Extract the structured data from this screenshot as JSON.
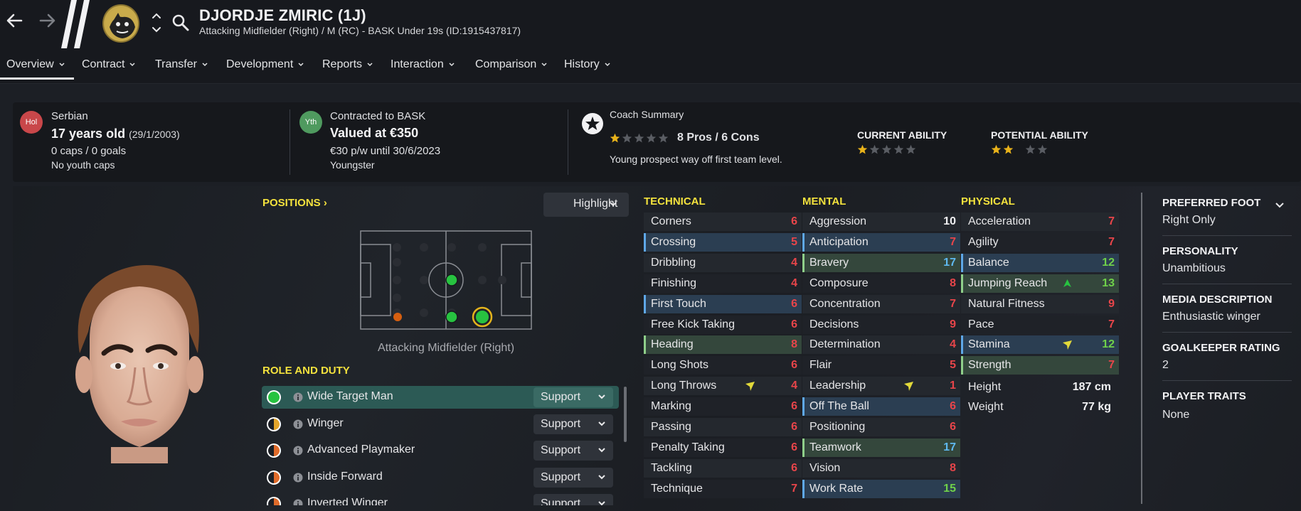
{
  "colors": {
    "accent_yellow": "#f4e23d",
    "value_red": "#e8454a",
    "value_white": "#f0f0f2",
    "value_blue": "#5fb9f0",
    "value_green": "#6fd14a",
    "star_gold": "#e8b21a",
    "star_empty": "#5a5d63",
    "nationality_badge": "#c9474a",
    "contract_badge": "#4f9a5f"
  },
  "header": {
    "back_icon": "arrow-left-icon",
    "forward_icon": "arrow-right-icon",
    "player_name": "DJORDJE ZMIRIC (1J)",
    "player_subtitle": "Attacking Midfielder (Right) / M (RC) - BASK Under 19s (ID:1915437817)"
  },
  "tabs": [
    {
      "label": "Overview"
    },
    {
      "label": "Contract"
    },
    {
      "label": "Transfer"
    },
    {
      "label": "Development"
    },
    {
      "label": "Reports"
    },
    {
      "label": "Interaction"
    },
    {
      "label": "Comparison"
    },
    {
      "label": "History"
    }
  ],
  "summary": {
    "nationality_badge": "Hol",
    "nationality": "Serbian",
    "age": "17 years old",
    "dob": "(29/1/2003)",
    "caps": "0 caps / 0 goals",
    "youth_caps": "No youth caps",
    "contract_badge": "Yth",
    "contracted_to": "Contracted to BASK",
    "value": "Valued at €350",
    "wage": "€30 p/w until 30/6/2023",
    "status": "Youngster",
    "coach_summary_label": "Coach Summary",
    "coach_stars": 1,
    "pros_cons": "8 Pros / 6 Cons",
    "coach_note": "Young prospect way off first team level.",
    "current_ability_label": "CURRENT ABILITY",
    "current_ability_stars": 1,
    "potential_ability_label": "POTENTIAL ABILITY",
    "potential_ability_stars": 2
  },
  "positions": {
    "title": "POSITIONS",
    "highlight_label": "Highlight",
    "caption": "Attacking Midfielder (Right)"
  },
  "roles": {
    "title": "ROLE AND DUTY",
    "items": [
      {
        "name": "Wide Target Man",
        "duty": "Support",
        "suitability": "full"
      },
      {
        "name": "Winger",
        "duty": "Support",
        "suitability": "half"
      },
      {
        "name": "Advanced Playmaker",
        "duty": "Support",
        "suitability": "half"
      },
      {
        "name": "Inside Forward",
        "duty": "Support",
        "suitability": "half"
      },
      {
        "name": "Inverted Winger",
        "duty": "Support",
        "suitability": "half"
      }
    ]
  },
  "technical": {
    "title": "TECHNICAL",
    "rows": [
      {
        "name": "Corners",
        "value": "6",
        "color": "red",
        "hl": ""
      },
      {
        "name": "Crossing",
        "value": "5",
        "color": "red",
        "hl": "blue"
      },
      {
        "name": "Dribbling",
        "value": "4",
        "color": "red",
        "hl": ""
      },
      {
        "name": "Finishing",
        "value": "4",
        "color": "red",
        "hl": ""
      },
      {
        "name": "First Touch",
        "value": "6",
        "color": "red",
        "hl": "blue"
      },
      {
        "name": "Free Kick Taking",
        "value": "6",
        "color": "red",
        "hl": ""
      },
      {
        "name": "Heading",
        "value": "8",
        "color": "red",
        "hl": "green"
      },
      {
        "name": "Long Shots",
        "value": "6",
        "color": "red",
        "hl": ""
      },
      {
        "name": "Long Throws",
        "value": "4",
        "color": "red",
        "hl": "",
        "icon": "arrow-down-icon"
      },
      {
        "name": "Marking",
        "value": "6",
        "color": "red",
        "hl": ""
      },
      {
        "name": "Passing",
        "value": "6",
        "color": "red",
        "hl": ""
      },
      {
        "name": "Penalty Taking",
        "value": "6",
        "color": "red",
        "hl": ""
      },
      {
        "name": "Tackling",
        "value": "6",
        "color": "red",
        "hl": ""
      },
      {
        "name": "Technique",
        "value": "7",
        "color": "red",
        "hl": ""
      }
    ]
  },
  "mental": {
    "title": "MENTAL",
    "rows": [
      {
        "name": "Aggression",
        "value": "10",
        "color": "white",
        "hl": ""
      },
      {
        "name": "Anticipation",
        "value": "7",
        "color": "red",
        "hl": "blue"
      },
      {
        "name": "Bravery",
        "value": "17",
        "color": "blue",
        "hl": "green"
      },
      {
        "name": "Composure",
        "value": "8",
        "color": "red",
        "hl": ""
      },
      {
        "name": "Concentration",
        "value": "7",
        "color": "red",
        "hl": ""
      },
      {
        "name": "Decisions",
        "value": "9",
        "color": "red",
        "hl": ""
      },
      {
        "name": "Determination",
        "value": "4",
        "color": "red",
        "hl": ""
      },
      {
        "name": "Flair",
        "value": "5",
        "color": "red",
        "hl": ""
      },
      {
        "name": "Leadership",
        "value": "1",
        "color": "red",
        "hl": "",
        "icon": "arrow-down-icon"
      },
      {
        "name": "Off The Ball",
        "value": "6",
        "color": "red",
        "hl": "blue"
      },
      {
        "name": "Positioning",
        "value": "6",
        "color": "red",
        "hl": ""
      },
      {
        "name": "Teamwork",
        "value": "17",
        "color": "blue",
        "hl": "green"
      },
      {
        "name": "Vision",
        "value": "8",
        "color": "red",
        "hl": ""
      },
      {
        "name": "Work Rate",
        "value": "15",
        "color": "green",
        "hl": "blue"
      }
    ]
  },
  "physical": {
    "title": "PHYSICAL",
    "rows": [
      {
        "name": "Acceleration",
        "value": "7",
        "color": "red",
        "hl": ""
      },
      {
        "name": "Agility",
        "value": "7",
        "color": "red",
        "hl": ""
      },
      {
        "name": "Balance",
        "value": "12",
        "color": "green",
        "hl": "blue"
      },
      {
        "name": "Jumping Reach",
        "value": "13",
        "color": "green",
        "hl": "green",
        "icon": "arrow-up-icon"
      },
      {
        "name": "Natural Fitness",
        "value": "9",
        "color": "red",
        "hl": ""
      },
      {
        "name": "Pace",
        "value": "7",
        "color": "red",
        "hl": ""
      },
      {
        "name": "Stamina",
        "value": "12",
        "color": "green",
        "hl": "blue",
        "icon": "arrow-down-icon"
      },
      {
        "name": "Strength",
        "value": "7",
        "color": "red",
        "hl": "green"
      }
    ],
    "height_label": "Height",
    "height_value": "187 cm",
    "weight_label": "Weight",
    "weight_value": "77 kg"
  },
  "side": {
    "foot_title": "PREFERRED FOOT",
    "foot_value": "Right Only",
    "personality_title": "PERSONALITY",
    "personality_value": "Unambitious",
    "media_title": "MEDIA DESCRIPTION",
    "media_value": "Enthusiastic winger",
    "gk_title": "GOALKEEPER RATING",
    "gk_value": "2",
    "traits_title": "PLAYER TRAITS",
    "traits_value": "None"
  }
}
